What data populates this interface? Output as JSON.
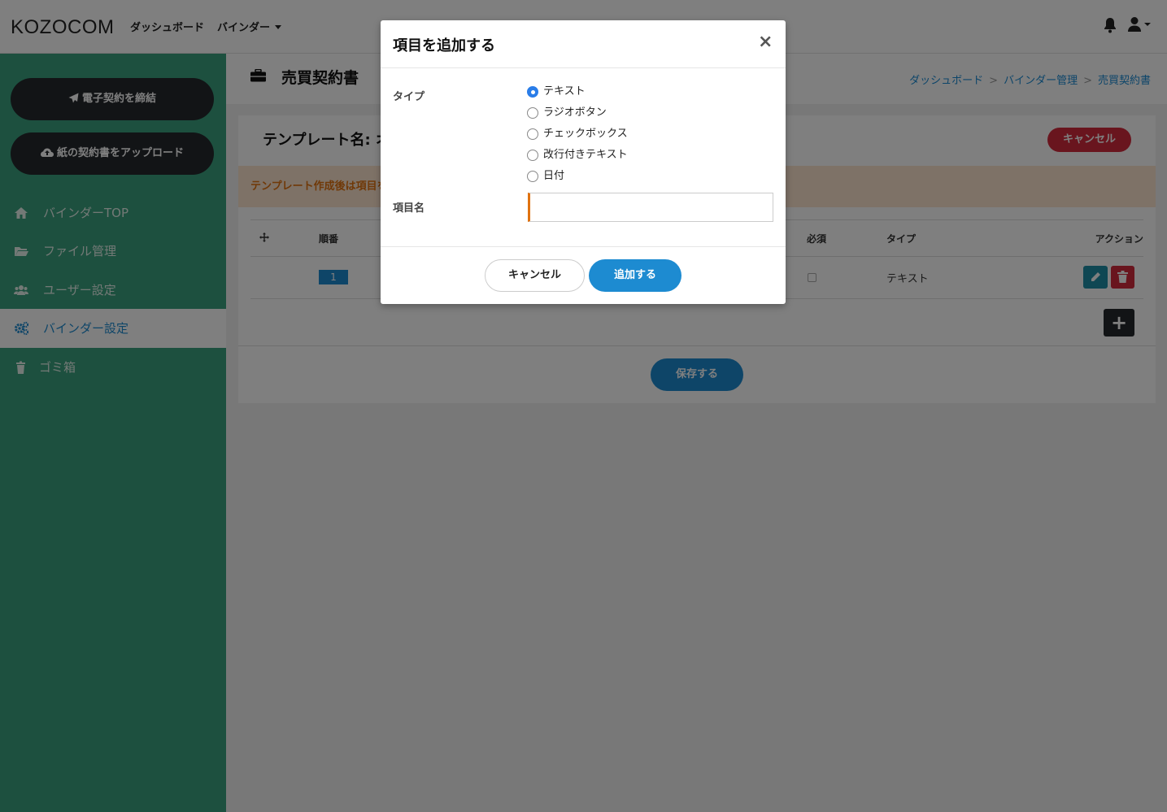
{
  "header": {
    "logo": "KOZOCOM",
    "nav": [
      {
        "label": "ダッシュボード"
      },
      {
        "label": "バインダー"
      }
    ]
  },
  "sidebar": {
    "buttons": [
      {
        "label": "電子契約を締結"
      },
      {
        "label": "紙の契約書をアップロード"
      }
    ],
    "items": [
      {
        "label": "バインダーTOP",
        "icon": "home-icon"
      },
      {
        "label": "ファイル管理",
        "icon": "folder-icon"
      },
      {
        "label": "ユーザー設定",
        "icon": "users-icon"
      },
      {
        "label": "バインダー設定",
        "icon": "gears-icon",
        "active": true
      },
      {
        "label": "ゴミ箱",
        "icon": "trash-icon"
      }
    ]
  },
  "page": {
    "title": "売買契約書",
    "breadcrumbs": [
      "ダッシュボード",
      "バインダー管理",
      "売買契約書"
    ],
    "template_label": "テンプレート名: オ",
    "cancel_label": "キャンセル",
    "notice": "テンプレート作成後は項目を",
    "table": {
      "headers": [
        "順番",
        "必須",
        "タイプ",
        "アクション"
      ],
      "rows": [
        {
          "order": "1",
          "type": "テキスト"
        }
      ]
    },
    "add_symbol": "+",
    "save_label": "保存する"
  },
  "modal": {
    "title": "項目を追加する",
    "close": "×",
    "type_label": "タイプ",
    "options": [
      "テキスト",
      "ラジオボタン",
      "チェックボックス",
      "改行付きテキスト",
      "日付"
    ],
    "selected_option": "テキスト",
    "name_label": "項目名",
    "name_value": "",
    "cancel_label": "キャンセル",
    "add_label": "追加する"
  },
  "colors": {
    "sidebar": "#3aa17f",
    "primary": "#1d8bd1",
    "danger": "#d32b3d",
    "dark": "#24282c",
    "notice_bg": "#fde5cf",
    "notice_text": "#e07210"
  }
}
